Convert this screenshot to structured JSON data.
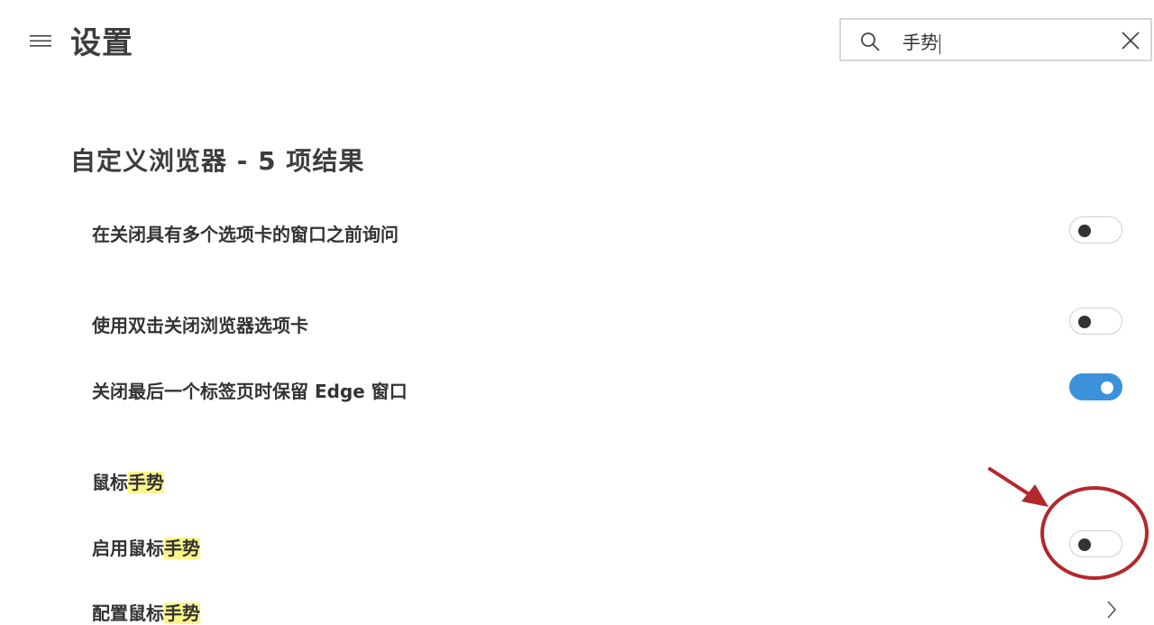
{
  "header": {
    "title": "设置",
    "menu_icon": "hamburger-icon"
  },
  "search": {
    "value": "手势",
    "icons": [
      "search-icon",
      "close-icon"
    ]
  },
  "section": {
    "title": "自定义浏览器 - 5 项结果"
  },
  "settings": [
    {
      "label": "在关闭具有多个选项卡的窗口之前询问",
      "control": "toggle",
      "state": "off"
    },
    {
      "label": "使用双击关闭浏览器选项卡",
      "control": "toggle",
      "state": "off"
    },
    {
      "label": "关闭最后一个标签页时保留 Edge 窗口",
      "control": "toggle",
      "state": "on"
    },
    {
      "label_prefix": "鼠标",
      "label_highlight": "手势",
      "control": "none"
    },
    {
      "label_prefix": "启用鼠标",
      "label_highlight": "手势",
      "control": "toggle",
      "state": "off"
    },
    {
      "label_prefix": "配置鼠标",
      "label_highlight": "手势",
      "control": "chevron-right-icon"
    }
  ],
  "colors": {
    "toggle_on": "#3b92da",
    "highlight": "#fbf68c",
    "annotation": "#b3282b"
  }
}
